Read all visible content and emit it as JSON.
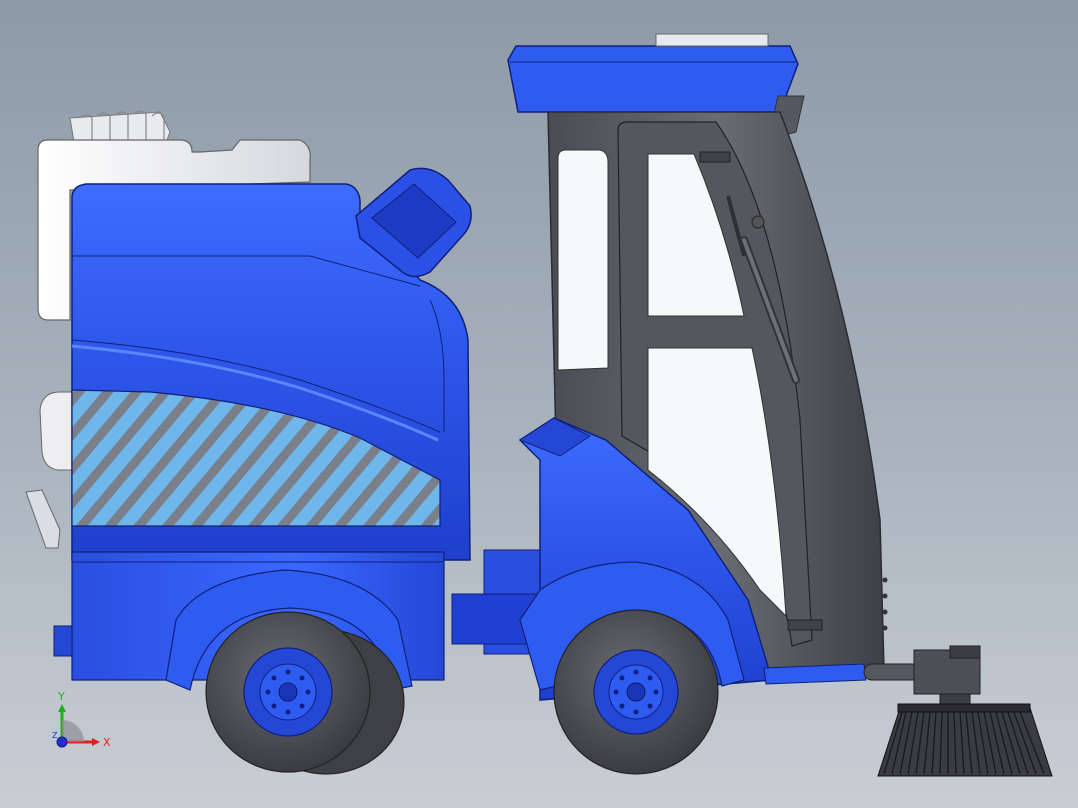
{
  "triad": {
    "x_label": "X",
    "y_label": "Y",
    "z_label": "Z"
  },
  "colors": {
    "background_top": "#8e9aa8",
    "background_bottom": "#c9ced4",
    "body_blue": "#2f5cf0",
    "body_blue_dark": "#1a36b8",
    "cab_frame": "#5c5e66",
    "tire": "#4a4c52",
    "white_part": "#f2f2f4",
    "glass": "#f7f8fa",
    "hatch_fill": "#6fb6ea",
    "hatch_stripe": "#7a7f8a",
    "axis_x": "#e02020",
    "axis_y": "#20b020",
    "axis_z": "#2030d0"
  },
  "model": {
    "name": "street-sweeper-side-view"
  }
}
